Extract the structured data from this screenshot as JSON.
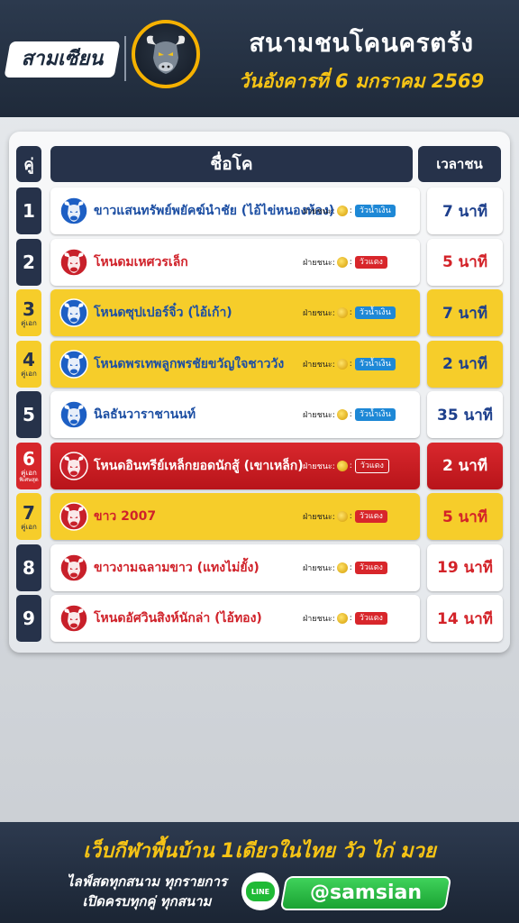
{
  "header": {
    "brand": "สามเซียน",
    "title": "สนามชนโคนครตรัง",
    "date": "วันอังคารที่ 6 มกราคม 2569"
  },
  "table": {
    "col_pair": "คู่",
    "col_name": "ชื่อโค",
    "col_time": "เวลาชน",
    "winner_label": "ฝ่ายชนะ:",
    "rows": [
      {
        "no": "1",
        "tag": "",
        "tag2": "",
        "name": "ขาวแสนทรัพย์พยัคฆ์นำชัย (ไอ้ไข่หนองห้อง)",
        "side": "วัวน้ำเงิน",
        "time": "7 นาที",
        "style": "white",
        "team": "blue"
      },
      {
        "no": "2",
        "tag": "",
        "tag2": "",
        "name": "โหนดมเหศวรเล็ก",
        "side": "วัวแดง",
        "time": "5 นาที",
        "style": "white",
        "team": "red"
      },
      {
        "no": "3",
        "tag": "คู่เอก",
        "tag2": "",
        "name": "โหนดซุปเปอร์จิ๋ว (ไอ้เก้า)",
        "side": "วัวน้ำเงิน",
        "time": "7 นาที",
        "style": "gold",
        "team": "blue"
      },
      {
        "no": "4",
        "tag": "คู่เอก",
        "tag2": "",
        "name": "โหนดพรเทพลูกพรชัยขวัญใจชาววัง",
        "side": "วัวน้ำเงิน",
        "time": "2 นาที",
        "style": "gold",
        "team": "blue"
      },
      {
        "no": "5",
        "tag": "",
        "tag2": "",
        "name": "นิลธันวาราชานนท์",
        "side": "วัวน้ำเงิน",
        "time": "35 นาที",
        "style": "white",
        "team": "blue"
      },
      {
        "no": "6",
        "tag": "คู่เอก",
        "tag2": "พิเศษสุด",
        "name": "โหนดอินทรีย์เหล็กยอดนักสู้ (เขาเหล็ก)",
        "side": "วัวแดง",
        "time": "2 นาที",
        "style": "red",
        "team": "red"
      },
      {
        "no": "7",
        "tag": "คู่เอก",
        "tag2": "",
        "name": "ขาว 2007",
        "side": "วัวแดง",
        "time": "5 นาที",
        "style": "gold",
        "team": "red"
      },
      {
        "no": "8",
        "tag": "",
        "tag2": "",
        "name": "ขาวงามฉลามขาว (แทงไม่ยั้ง)",
        "side": "วัวแดง",
        "time": "19 นาที",
        "style": "white",
        "team": "red"
      },
      {
        "no": "9",
        "tag": "",
        "tag2": "",
        "name": "โหนดอัศวินสิงห์นักล่า (ไอ้ทอง)",
        "side": "วัวแดง",
        "time": "14 นาที",
        "style": "white",
        "team": "red"
      }
    ]
  },
  "footer": {
    "tagline": "เว็บกีฬาพื้นบ้าน 1เดียวในไทย วัว ไก่ มวย",
    "line1": "ไลฟ์สดทุกสนาม ทุกรายการ",
    "line2": "เปิดครบทุกคู่ ทุกสนาม",
    "line_label": "LINE",
    "handle": "@samsian"
  },
  "colors": {
    "navy": "#26324a",
    "gold": "#f6cd2a",
    "red": "#d6262b",
    "blue_team": "#1d4fa3",
    "red_team": "#d0222a"
  }
}
